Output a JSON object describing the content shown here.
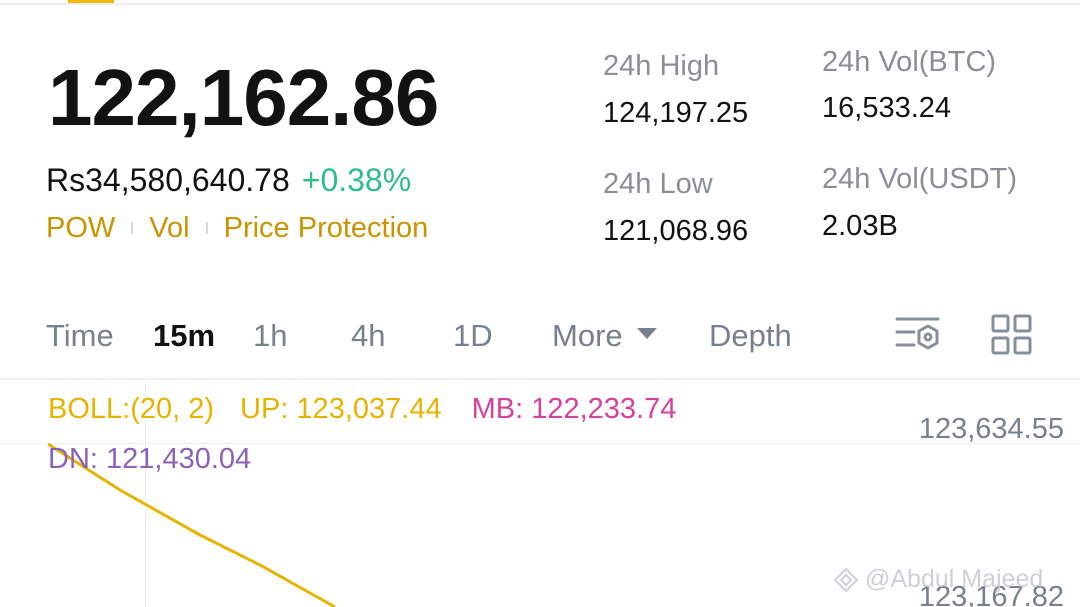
{
  "ticker": {
    "last_price": "122,162.86",
    "fiat_price": "Rs34,580,640.78",
    "change_pct": "+0.38%",
    "tags": [
      "POW",
      "Vol",
      "Price Protection"
    ]
  },
  "stats": {
    "high_label": "24h High",
    "high_value": "124,197.25",
    "low_label": "24h Low",
    "low_value": "121,068.96",
    "vol_btc_label": "24h Vol(BTC)",
    "vol_btc_value": "16,533.24",
    "vol_usdt_label": "24h Vol(USDT)",
    "vol_usdt_value": "2.03B"
  },
  "tabs": {
    "time": "Time",
    "m15": "15m",
    "h1": "1h",
    "h4": "4h",
    "d1": "1D",
    "more": "More",
    "depth": "Depth",
    "active": "15m"
  },
  "indicator": {
    "label": "BOLL:(20, 2)",
    "up": "UP: 123,037.44",
    "mb": "MB: 122,233.74",
    "dn": "DN: 121,430.04"
  },
  "axis": {
    "top": "123,634.55",
    "second": "123,167.82"
  },
  "watermark": {
    "text": "@Abdul Majeed"
  },
  "colors": {
    "accent": "#f0b90b",
    "positive": "#2ebd85",
    "boll_up": "#e6b400",
    "boll_mb": "#d6409f",
    "boll_dn": "#8a63b8"
  },
  "icons": {
    "indicator_settings": "indicator-settings-icon",
    "layout": "grid-layout-icon",
    "dropdown": "caret-down-icon",
    "watermark_logo": "binance-logo-icon"
  }
}
